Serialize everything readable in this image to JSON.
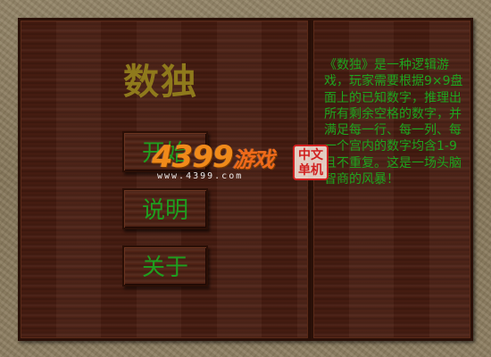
{
  "game": {
    "title": "数独"
  },
  "menu": {
    "start_label": "开始",
    "help_label": "说明",
    "about_label": "关于"
  },
  "description": "《数独》是一种逻辑游戏，玩家需要根据9×9盘面上的已知数字，推理出所有剩余空格的数字，并满足每一行、每一列、每一个宫内的数字均含1-9且不重复。这是一场头脑智商的风暴！",
  "watermark": {
    "brand": "4399",
    "brand_suffix": "游戏",
    "url": "www.4399.com",
    "seal_text": "中文单机"
  },
  "colors": {
    "title": "#8f7a1c",
    "menu_text": "#1f9e1f",
    "desc_text": "#1fa51f",
    "wood": "#4a1e12",
    "frame": "#8a7a5e"
  }
}
